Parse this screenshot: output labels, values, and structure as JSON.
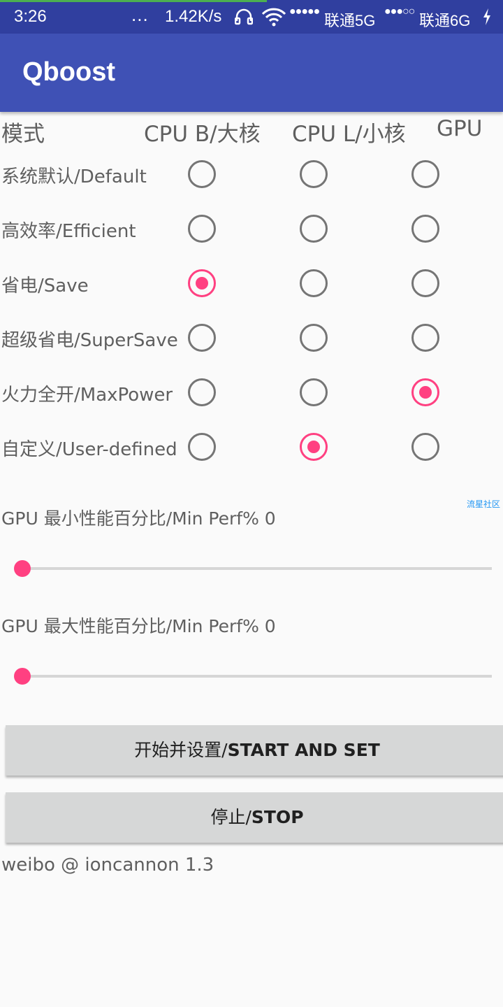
{
  "status_bar": {
    "time": "3:26",
    "dots": "...",
    "net_speed": "1.42K/s",
    "signal1": "●●●●●",
    "carrier1": "联通5G",
    "signal2": "●●●○○",
    "carrier2": "联通6G",
    "icons": [
      "headphones-icon",
      "wifi-icon",
      "charging-icon"
    ]
  },
  "app_bar": {
    "title": "Qboost"
  },
  "table": {
    "headers": {
      "mode": "模式",
      "cpu_big": "CPU B/大核",
      "cpu_little": "CPU L/小核",
      "gpu": "GPU"
    },
    "rows": [
      {
        "label": "系统默认/Default",
        "cpu_big": false,
        "cpu_little": false,
        "gpu": false
      },
      {
        "label": "高效率/Efficient",
        "cpu_big": false,
        "cpu_little": false,
        "gpu": false
      },
      {
        "label": "省电/Save",
        "cpu_big": true,
        "cpu_little": false,
        "gpu": false
      },
      {
        "label": "超级省电/SuperSave",
        "cpu_big": false,
        "cpu_little": false,
        "gpu": false
      },
      {
        "label": "火力全开/MaxPower",
        "cpu_big": false,
        "cpu_little": false,
        "gpu": true
      },
      {
        "label": "自定义/User-defined",
        "cpu_big": false,
        "cpu_little": true,
        "gpu": false
      }
    ]
  },
  "watermark": "流星社区",
  "sliders": [
    {
      "label": "GPU 最小性能百分比/Min Perf% 0",
      "value": 0
    },
    {
      "label": "GPU 最大性能百分比/Min Perf% 0",
      "value": 0
    }
  ],
  "buttons": {
    "start": {
      "prefix": "开始并设置/",
      "bold": "START AND SET"
    },
    "stop": {
      "prefix": "停止/",
      "bold": "STOP"
    }
  },
  "footer": "weibo @ ioncannon 1.3",
  "colors": {
    "primary": "#3f51b5",
    "primary_dark": "#303f9f",
    "accent": "#ff4081",
    "button": "#d6d7d7",
    "network_line": "#4caf50"
  }
}
